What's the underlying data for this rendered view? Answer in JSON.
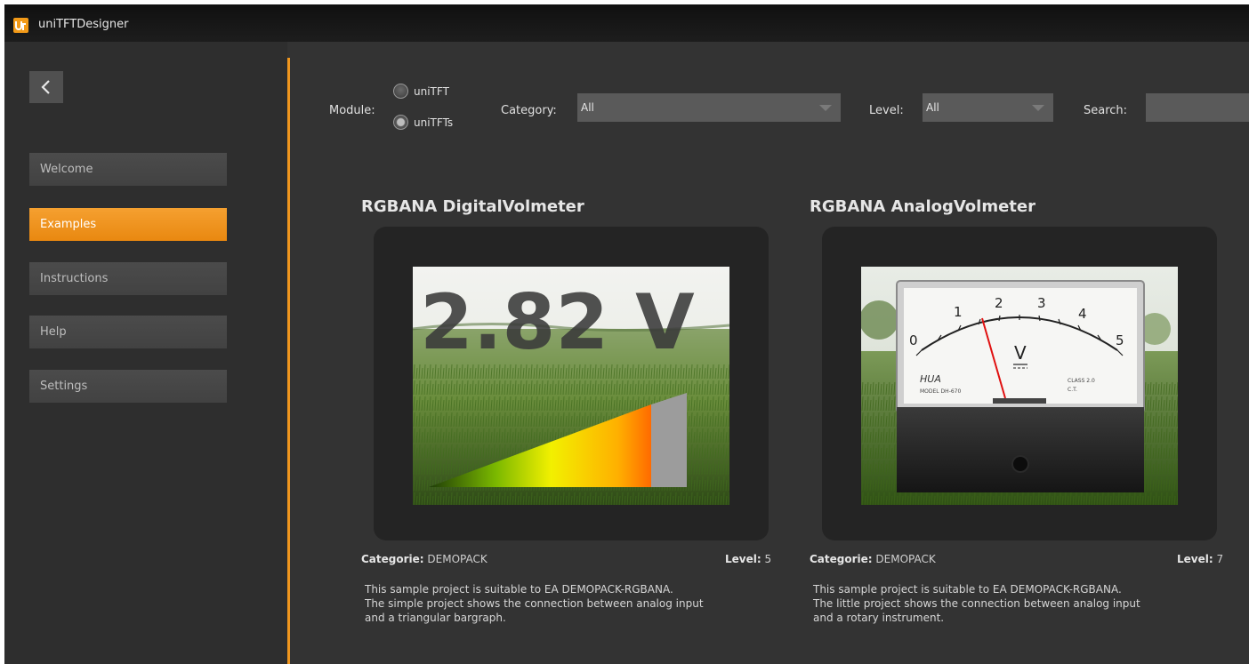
{
  "app": {
    "title": "uniTFTDesigner",
    "logo_icon": "unitft-logo-icon",
    "accent_color": "#f0961e"
  },
  "sidebar": {
    "back_icon": "chevron-left-icon",
    "items": [
      {
        "label": "Welcome",
        "active": false
      },
      {
        "label": "Examples",
        "active": true
      },
      {
        "label": "Instructions",
        "active": false
      },
      {
        "label": "Help",
        "active": false
      },
      {
        "label": "Settings",
        "active": false
      }
    ]
  },
  "filters": {
    "module_label": "Module:",
    "module_options": [
      {
        "label": "uniTFT",
        "checked": false
      },
      {
        "label": "uniTFTs",
        "checked": true
      }
    ],
    "category_label": "Category:",
    "category_value": "All",
    "level_label": "Level:",
    "level_value": "All",
    "search_label": "Search:",
    "search_value": ""
  },
  "cards": [
    {
      "title": "RGBANA DigitalVolmeter",
      "preview_value": "2.82 V",
      "categorie_label": "Categorie:",
      "categorie_value": "DEMOPACK",
      "level_label": "Level:",
      "level_value": "5",
      "description": [
        "This sample project is suitable to EA DEMOPACK-RGBANA.",
        "The simple project shows the connection between analog input",
        "and a triangular bargraph."
      ]
    },
    {
      "title": "RGBANA AnalogVolmeter",
      "meter_scale": [
        "0",
        "1",
        "2",
        "3",
        "4",
        "5"
      ],
      "meter_unit": "V",
      "meter_brand": "HUA",
      "meter_model": "MODEL DH-670",
      "meter_class": "CLASS  2.0",
      "meter_ct": "C.T.",
      "categorie_label": "Categorie:",
      "categorie_value": "DEMOPACK",
      "level_label": "Level:",
      "level_value": "7",
      "description": [
        "This sample project is suitable to EA DEMOPACK-RGBANA.",
        "The little project shows the connection between analog input",
        "and a rotary instrument."
      ]
    }
  ]
}
